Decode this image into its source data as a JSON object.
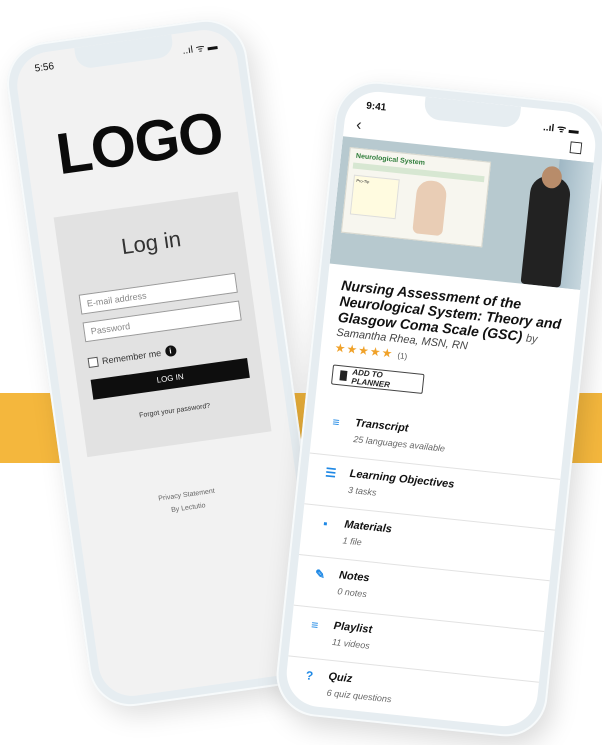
{
  "background": {
    "band_color": "#f4b73d"
  },
  "login_phone": {
    "time": "5:56",
    "status_icons": "..ıl ᯤ ▬",
    "logo": "LOGO",
    "title": "Log in",
    "email_placeholder": "E-mail address",
    "password_placeholder": "Password",
    "remember_label": "Remember me",
    "info_icon": "i",
    "login_button": "LOG IN",
    "forgot_link": "Forgot your password?",
    "footer_privacy": "Privacy Statement",
    "footer_by": "By Lectutio"
  },
  "course_phone": {
    "time": "9:41",
    "status_icons": "..ıl ᯤ ▬",
    "back_icon": "‹",
    "bookmark_icon": "☐",
    "video": {
      "slide_title": "Neurological System",
      "slide_box_title": "Pro-Tip"
    },
    "course_title": "Nursing Assessment of the Neurological System: Theory and Glasgow Coma Scale (GSC)",
    "by": "by",
    "author": "Samantha Rhea, MSN, RN",
    "stars": "★★★★★",
    "rating_count": "(1)",
    "add_to_planner": "ADD TO PLANNER",
    "accent_color": "#1e88e5",
    "items": [
      {
        "icon": "≡",
        "label": "Transcript",
        "sub": "25 languages available"
      },
      {
        "icon": "☰",
        "label": "Learning Objectives",
        "sub": "3 tasks"
      },
      {
        "icon": "▪",
        "label": "Materials",
        "sub": "1 file"
      },
      {
        "icon": "✎",
        "label": "Notes",
        "sub": "0 notes"
      },
      {
        "icon": "≡",
        "label": "Playlist",
        "sub": "11 videos"
      },
      {
        "icon": "?",
        "label": "Quiz",
        "sub": "6 quiz questions"
      }
    ]
  }
}
